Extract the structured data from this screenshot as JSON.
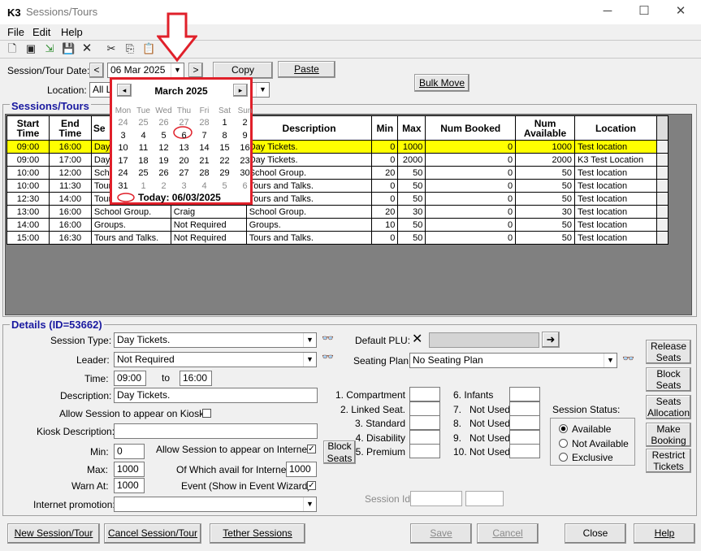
{
  "window": {
    "logo": "K3",
    "title": "Sessions/Tours",
    "min": "─",
    "max": "☐",
    "close": "✕"
  },
  "menu": [
    "File",
    "Edit",
    "Help"
  ],
  "toolbar_icons": [
    "new-icon",
    "save-all-icon",
    "export-icon",
    "disk-icon",
    "delete-icon",
    "cut-icon",
    "copy-icon",
    "paste-icon"
  ],
  "toolbar_glyphs": [
    "🗋",
    "▣",
    "⇲",
    "💾",
    "✕",
    "✂",
    "⎘",
    "📋"
  ],
  "top": {
    "date_label": "Session/Tour Date:",
    "date_value": "06 Mar 2025",
    "prev": "<",
    "next": ">",
    "copy": "Copy",
    "paste": "Paste",
    "location_label": "Location:",
    "location_value": "All L",
    "bulk_move": "Bulk Move"
  },
  "calendar": {
    "month": "March 2025",
    "prev": "◂",
    "next": "▸",
    "weekdays": [
      "Mon",
      "Tue",
      "Wed",
      "Thu",
      "Fri",
      "Sat",
      "Sun"
    ],
    "weeks": [
      [
        "24",
        "25",
        "26",
        "27",
        "28",
        "1",
        "2"
      ],
      [
        "3",
        "4",
        "5",
        "6",
        "7",
        "8",
        "9"
      ],
      [
        "10",
        "11",
        "12",
        "13",
        "14",
        "15",
        "16"
      ],
      [
        "17",
        "18",
        "19",
        "20",
        "21",
        "22",
        "23"
      ],
      [
        "24",
        "25",
        "26",
        "27",
        "28",
        "29",
        "30"
      ],
      [
        "31",
        "1",
        "2",
        "3",
        "4",
        "5",
        "6"
      ]
    ],
    "today_label": "Today: 06/03/2025"
  },
  "sessions": {
    "section_title": "Sessions/Tours",
    "columns": [
      "Start Time",
      "End Time",
      "Se",
      "",
      "Description",
      "Min",
      "Max",
      "Num Booked",
      "Num Available",
      "Location"
    ],
    "rows": [
      {
        "start": "09:00",
        "end": "16:00",
        "type": "Day",
        "leader": "",
        "desc": "Day Tickets.",
        "min": "0",
        "max": "1000",
        "booked": "0",
        "avail": "1000",
        "loc": "Test location",
        "sel": true
      },
      {
        "start": "09:00",
        "end": "17:00",
        "type": "Day",
        "leader": "",
        "desc": "Day Tickets.",
        "min": "0",
        "max": "2000",
        "booked": "0",
        "avail": "2000",
        "loc": "K3 Test Location",
        "sel": false
      },
      {
        "start": "10:00",
        "end": "12:00",
        "type": "Schoo",
        "leader": "",
        "desc": "School Group.",
        "min": "20",
        "max": "50",
        "booked": "0",
        "avail": "50",
        "loc": "Test location",
        "sel": false
      },
      {
        "start": "10:00",
        "end": "11:30",
        "type": "Tours",
        "leader": "",
        "desc": "Tours and Talks.",
        "min": "0",
        "max": "50",
        "booked": "0",
        "avail": "50",
        "loc": "Test location",
        "sel": false
      },
      {
        "start": "12:30",
        "end": "14:00",
        "type": "Tours",
        "leader": "",
        "desc": "Tours and Talks.",
        "min": "0",
        "max": "50",
        "booked": "0",
        "avail": "50",
        "loc": "Test location",
        "sel": false
      },
      {
        "start": "13:00",
        "end": "16:00",
        "type": "School Group.",
        "leader": "Craig",
        "desc": "School Group.",
        "min": "20",
        "max": "30",
        "booked": "0",
        "avail": "30",
        "loc": "Test location",
        "sel": false
      },
      {
        "start": "14:00",
        "end": "16:00",
        "type": "Groups.",
        "leader": "Not Required",
        "desc": "Groups.",
        "min": "10",
        "max": "50",
        "booked": "0",
        "avail": "50",
        "loc": "Test location",
        "sel": false
      },
      {
        "start": "15:00",
        "end": "16:30",
        "type": "Tours and Talks.",
        "leader": "Not Required",
        "desc": "Tours and Talks.",
        "min": "0",
        "max": "50",
        "booked": "0",
        "avail": "50",
        "loc": "Test location",
        "sel": false
      }
    ]
  },
  "details": {
    "section_title": "Details (ID=53662)",
    "session_type_label": "Session Type:",
    "session_type": "Day Tickets.",
    "leader_label": "Leader:",
    "leader": "Not Required",
    "time_label": "Time:",
    "time_from": "09:00",
    "time_to_label": "to",
    "time_to": "16:00",
    "description_label": "Description:",
    "description": "Day Tickets.",
    "kiosk_allow_label": "Allow Session to appear on Kiosk",
    "kiosk_desc_label": "Kiosk Description:",
    "kiosk_desc": "",
    "min_label": "Min:",
    "min": "0",
    "max_label": "Max:",
    "max": "1000",
    "warn_label": "Warn At:",
    "warn": "1000",
    "internet_allow_label": "Allow Session to appear on Internet",
    "internet_avail_label": "Of Which avail for Internet:",
    "internet_avail": "1000",
    "event_label": "Event (Show in Event Wizard)",
    "internet_promo_label": "Internet promotion:",
    "internet_promo": "",
    "block_seats": "Block Seats",
    "default_plu_label": "Default PLU:",
    "seating_plan_label": "Seating Plan:",
    "seating_plan": "No Seating Plan",
    "tickets_left": [
      "1. Compartment",
      "2. Linked Seat.",
      "3. Standard",
      "4. Disability",
      "5. Premium"
    ],
    "tickets_right": [
      "6. Infants",
      "7.   Not Used",
      "8.   Not Used",
      "9.   Not Used",
      "10. Not Used"
    ],
    "session_status_label": "Session Status:",
    "status_options": [
      "Available",
      "Not Available",
      "Exclusive"
    ],
    "session_id_label": "Session Id"
  },
  "side_buttons": [
    "Release Seats",
    "Block Seats",
    "Seats Allocation",
    "Make Booking",
    "Restrict Tickets"
  ],
  "bottom_buttons": {
    "new": "New Session/Tour",
    "cancel_session": "Cancel Session/Tour",
    "tether": "Tether Sessions",
    "save": "Save",
    "cancel": "Cancel",
    "close": "Close",
    "help": "Help"
  },
  "colors": {
    "selected_row": "#ffff00",
    "annotation_red": "#e0202a",
    "section_title": "#1a1aa0"
  }
}
